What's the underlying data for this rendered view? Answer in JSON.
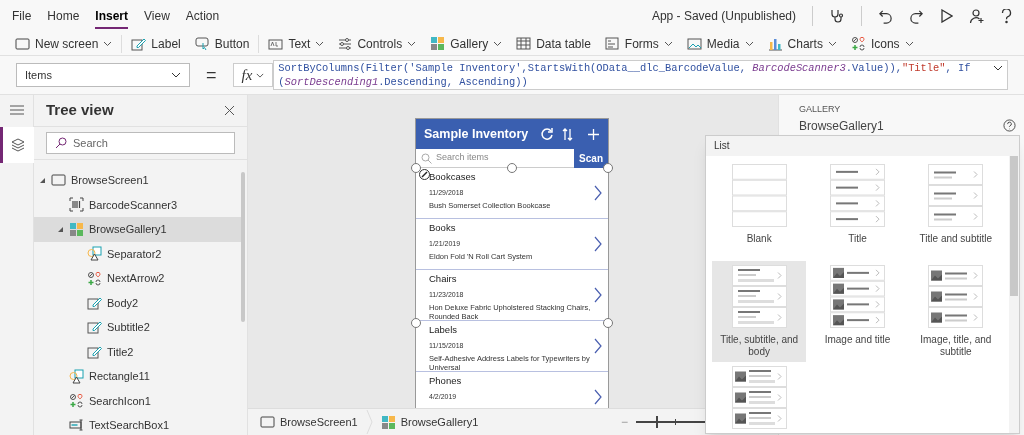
{
  "menu": [
    {
      "label": "File",
      "selected": false
    },
    {
      "label": "Home",
      "selected": false
    },
    {
      "label": "Insert",
      "selected": true
    },
    {
      "label": "View",
      "selected": false
    },
    {
      "label": "Action",
      "selected": false
    }
  ],
  "app_status": "App - Saved (Unpublished)",
  "toolbar": [
    {
      "label": "New screen",
      "kind": "screen",
      "dropdown": true
    },
    {
      "label": "Label",
      "kind": "label",
      "dropdown": false
    },
    {
      "label": "Button",
      "kind": "button",
      "dropdown": false
    },
    {
      "label": "Text",
      "kind": "text",
      "dropdown": true
    },
    {
      "label": "Controls",
      "kind": "controls",
      "dropdown": true
    },
    {
      "label": "Gallery",
      "kind": "gallery",
      "dropdown": true
    },
    {
      "label": "Data table",
      "kind": "table",
      "dropdown": false
    },
    {
      "label": "Forms",
      "kind": "forms",
      "dropdown": true
    },
    {
      "label": "Media",
      "kind": "media",
      "dropdown": true
    },
    {
      "label": "Charts",
      "kind": "charts",
      "dropdown": true
    },
    {
      "label": "Icons",
      "kind": "icons",
      "dropdown": true
    }
  ],
  "formula_bar": {
    "property": "Items",
    "equals": "=",
    "fx": "fx",
    "lines": [
      [
        {
          "text": "SortByColumns(Filter('Sample Inventory',StartsWith(OData__dlc_BarcodeValue, ",
          "kind": "code"
        },
        {
          "text": "BarcodeScanner3",
          "kind": "control"
        },
        {
          "text": ".Value)),",
          "kind": "code"
        },
        {
          "text": "\"Title\"",
          "kind": "string"
        },
        {
          "text": ", If",
          "kind": "code"
        }
      ],
      [
        {
          "text": "(",
          "kind": "code"
        },
        {
          "text": "SortDescending1",
          "kind": "control"
        },
        {
          "text": ".Descending, Ascending))",
          "kind": "code"
        }
      ]
    ]
  },
  "tree_view": {
    "title": "Tree view",
    "search": {
      "placeholder": "Search"
    },
    "items": [
      {
        "label": "BrowseScreen1",
        "kind": "screen",
        "selected": false,
        "expanded": true,
        "children": [
          {
            "label": "BarcodeScanner3",
            "kind": "barcode",
            "selected": false
          },
          {
            "label": "BrowseGallery1",
            "kind": "gallery",
            "selected": true,
            "expanded": true,
            "children": [
              {
                "label": "Separator2",
                "kind": "shape",
                "selected": false
              },
              {
                "label": "NextArrow2",
                "kind": "icons",
                "selected": false
              },
              {
                "label": "Body2",
                "kind": "label",
                "selected": false
              },
              {
                "label": "Subtitle2",
                "kind": "label",
                "selected": false
              },
              {
                "label": "Title2",
                "kind": "label",
                "selected": false
              }
            ]
          },
          {
            "label": "Rectangle11",
            "kind": "shape",
            "selected": false
          },
          {
            "label": "SearchIcon1",
            "kind": "icons",
            "selected": false
          },
          {
            "label": "TextSearchBox1",
            "kind": "textinput",
            "selected": false
          }
        ]
      }
    ]
  },
  "app_preview": {
    "title": "Sample Inventory",
    "search": {
      "placeholder": "Search items"
    },
    "scan_button": "Scan",
    "items": [
      {
        "title": "Bookcases",
        "date": "11/29/2018",
        "body": "Bush Somerset Collection Bookcase"
      },
      {
        "title": "Books",
        "date": "1/21/2019",
        "body": "Eldon Fold 'N Roll Cart System"
      },
      {
        "title": "Chairs",
        "date": "11/23/2018",
        "body": "Hon Deluxe Fabric Upholstered Stacking Chairs, Rounded Back"
      },
      {
        "title": "Labels",
        "date": "11/15/2018",
        "body": "Self-Adhesive Address Labels for Typewriters by Universal"
      },
      {
        "title": "Phones",
        "date": "4/2/2019"
      }
    ]
  },
  "breadcrumbs": [
    {
      "label": "BrowseScreen1",
      "kind": "screen"
    },
    {
      "label": "BrowseGallery1",
      "kind": "gallery"
    }
  ],
  "zoom": {
    "out_label": "−",
    "level": 0.15
  },
  "properties": {
    "section": "GALLERY",
    "name": "BrowseGallery1"
  },
  "layout_popup": {
    "title": "List",
    "layouts": [
      {
        "label": "Blank",
        "kind": "blank",
        "selected": false
      },
      {
        "label": "Title",
        "kind": "title",
        "selected": false
      },
      {
        "label": "Title and subtitle",
        "kind": "title-subtitle",
        "selected": false
      },
      {
        "label": "Title, subtitle, and body",
        "kind": "title-subtitle-body",
        "selected": true
      },
      {
        "label": "Image and title",
        "kind": "image-title",
        "selected": false
      },
      {
        "label": "Image, title, and subtitle",
        "kind": "image-title-subtitle",
        "selected": false
      },
      {
        "kind": "image-title-subtitle-body",
        "selected": false
      }
    ]
  }
}
